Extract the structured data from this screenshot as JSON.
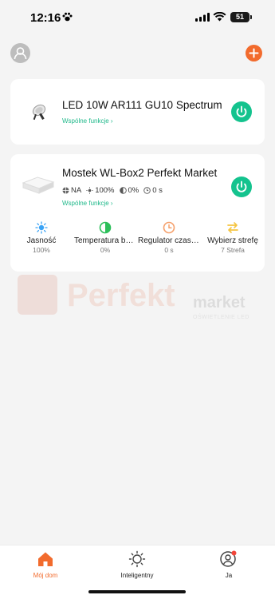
{
  "status_bar": {
    "time": "12:16",
    "battery": "51"
  },
  "header": {
    "avatar_icon": "user-icon",
    "add_icon": "plus-icon",
    "add_color": "#f26b2d"
  },
  "devices": [
    {
      "title": "LED 10W AR111 GU10 Spectrum",
      "func_label": "Wspólne funkcje ",
      "func_arrow": "›",
      "power_color": "#14c38e"
    },
    {
      "title": "Mostek WL-Box2 Perfekt Market",
      "func_label": "Wspólne funkcje ",
      "func_arrow": "›",
      "power_color": "#14c38e",
      "states": {
        "na": "NA",
        "brightness": "100%",
        "temperature": "0%",
        "timer": "0 s"
      },
      "functions": [
        {
          "label": "Jasność",
          "value": "100%",
          "icon": "sun-icon",
          "color": "#3aa3f5"
        },
        {
          "label": "Temperatura barwowa",
          "value": "0%",
          "icon": "half-circle-icon",
          "color": "#2dbf5a"
        },
        {
          "label": "Regulator czasowy",
          "value": "0 s",
          "icon": "clock-icon",
          "color": "#f5a06b"
        },
        {
          "label": "Wybierz strefę",
          "value": "7 Strefa",
          "icon": "swap-icon",
          "color": "#f5c542"
        }
      ]
    }
  ],
  "watermark": {
    "brand": "Perfekt",
    "brand2": "market",
    "tagline": "OŚWIETLENIE LED"
  },
  "nav": [
    {
      "label": "Mój dom",
      "icon": "home-icon",
      "active": true
    },
    {
      "label": "Inteligentny",
      "icon": "smart-icon",
      "active": false
    },
    {
      "label": "Ja",
      "icon": "profile-icon",
      "active": false
    }
  ]
}
